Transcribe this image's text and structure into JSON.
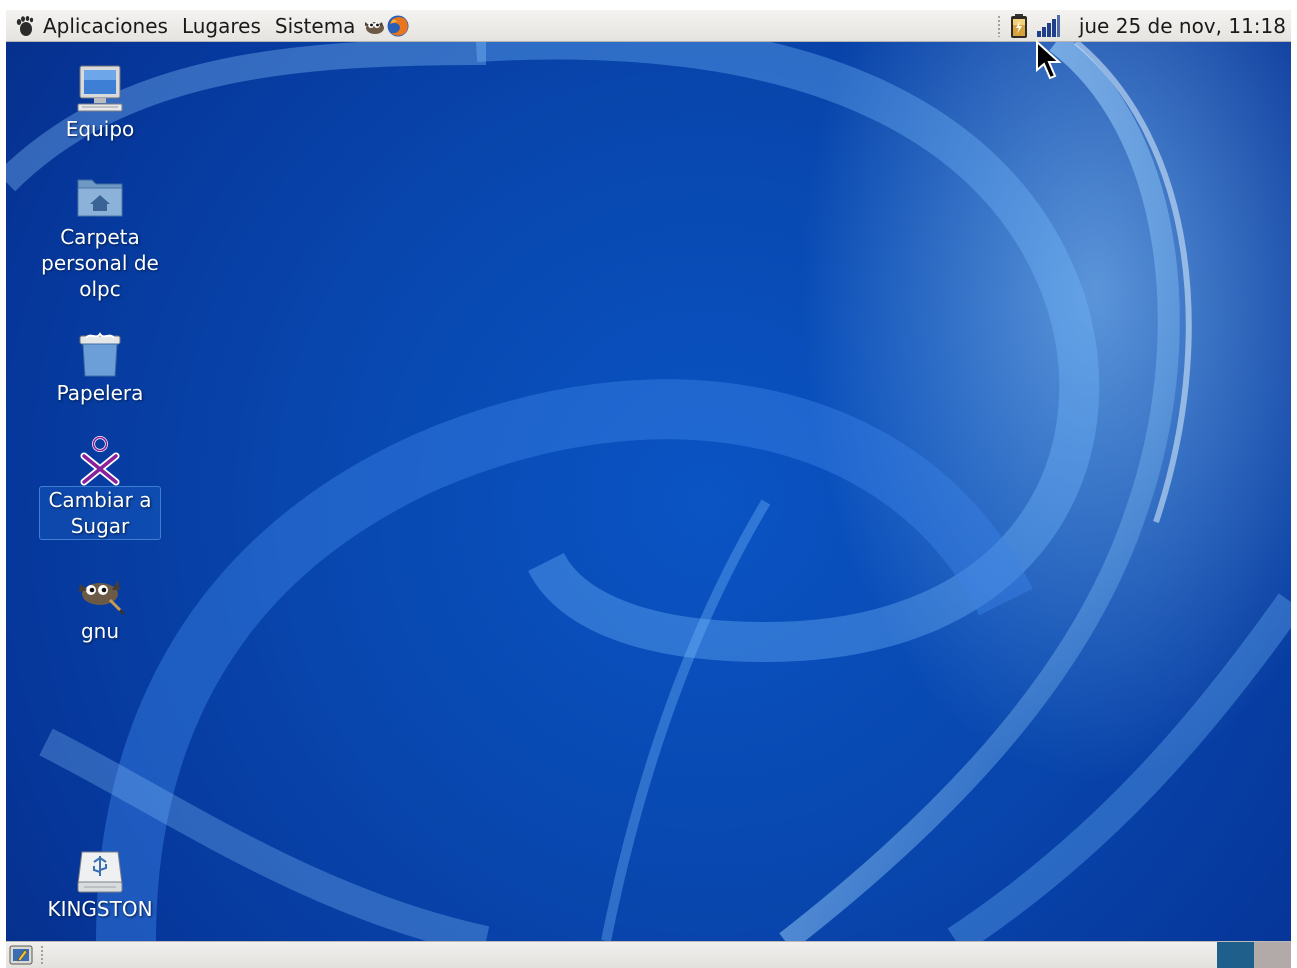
{
  "top_panel": {
    "menus": [
      "Aplicaciones",
      "Lugares",
      "Sistema"
    ],
    "launchers": [
      "gimp-launcher-icon",
      "firefox-launcher-icon"
    ],
    "tray_icons": [
      "battery-icon",
      "network-signal-icon"
    ],
    "clock": "jue 25 de nov, 11:18"
  },
  "desktop": {
    "icons": [
      {
        "label": "Equipo",
        "icon": "computer-icon"
      },
      {
        "label": "Carpeta\npersonal de\nolpc",
        "icon": "home-folder-icon"
      },
      {
        "label": "Papelera",
        "icon": "trash-icon"
      },
      {
        "label": "Cambiar a\nSugar",
        "icon": "sugar-xo-icon",
        "selected": true
      },
      {
        "label": "gnu",
        "icon": "gimp-icon"
      },
      {
        "label": "KINGSTON",
        "icon": "usb-drive-icon"
      }
    ]
  },
  "bottom_panel": {
    "workspaces": 2,
    "active_workspace": 1
  },
  "colors": {
    "panel_bg": "#e9e7e3",
    "desktop_blue": "#0846ad",
    "workspace_active": "#1f5f8c",
    "workspace_inactive": "#b2a9a9",
    "sugar_purple": "#8a1f9c"
  }
}
